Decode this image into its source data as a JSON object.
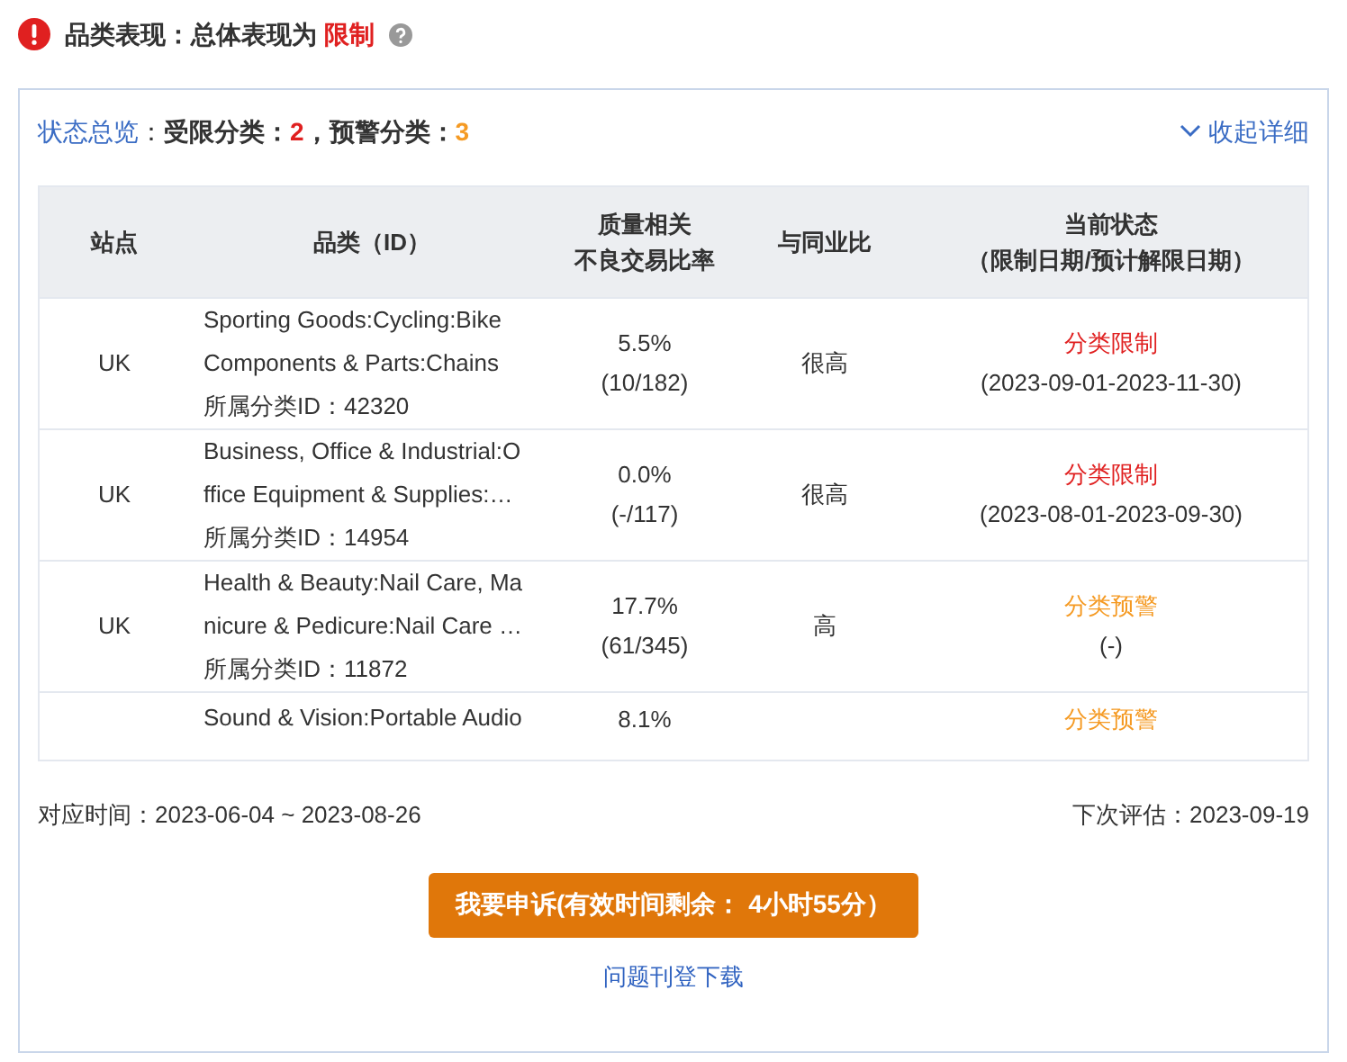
{
  "heading": {
    "label": "品类表现：总体表现为",
    "status": "限制"
  },
  "overview": {
    "label": "状态总览",
    "label_colon": "：",
    "restricted_label": "受限分类：",
    "restricted_count": "2",
    "separator": "，",
    "warning_label": "预警分类：",
    "warning_count": "3",
    "collapse": "收起详细"
  },
  "table": {
    "columns": [
      "站点",
      "品类（ID）",
      [
        "质量相关",
        "不良交易比率"
      ],
      "与同业比",
      [
        "当前状态",
        "（限制日期/预计解限日期）"
      ]
    ],
    "rows": [
      {
        "kind": "full",
        "site": "UK",
        "name_lines": [
          "Sporting Goods:Cycling:Bike",
          "Components & Parts:Chains"
        ],
        "category_id": "所属分类ID：42320",
        "rate": "5.5%",
        "ratio": "(10/182)",
        "compare": "很高",
        "status": "分类限制",
        "color": "#e02020",
        "dates": "(2023-09-01-2023-11-30)"
      },
      {
        "kind": "full",
        "site": "UK",
        "name_lines": [
          "Business, Office & Industrial:O",
          "ffice Equipment & Supplies:…"
        ],
        "category_id": "所属分类ID：14954",
        "rate": "0.0%",
        "ratio": "(-/117)",
        "compare": "很高",
        "status": "分类限制",
        "color": "#e02020",
        "dates": "(2023-08-01-2023-09-30)"
      },
      {
        "kind": "full",
        "site": "UK",
        "name_lines": [
          "Health & Beauty:Nail Care, Ma",
          "nicure & Pedicure:Nail Care …"
        ],
        "category_id": "所属分类ID：11872",
        "rate": "17.7%",
        "ratio": "(61/345)",
        "compare": "高",
        "status": "分类预警",
        "color": "#f59a23",
        "dates": "(-)"
      },
      {
        "kind": "partial",
        "name_lines": [
          "Sound & Vision:Portable Audio"
        ],
        "rate": "8.1%",
        "status": "分类预警",
        "color": "#f59a23"
      }
    ]
  },
  "footer": {
    "period": "对应时间：2023-06-04 ~ 2023-08-26",
    "next": "下次评估：2023-09-19"
  },
  "appeal_button": "我要申诉(有效时间剩余： 4小时55分）",
  "download_link": "问题刊登下载"
}
